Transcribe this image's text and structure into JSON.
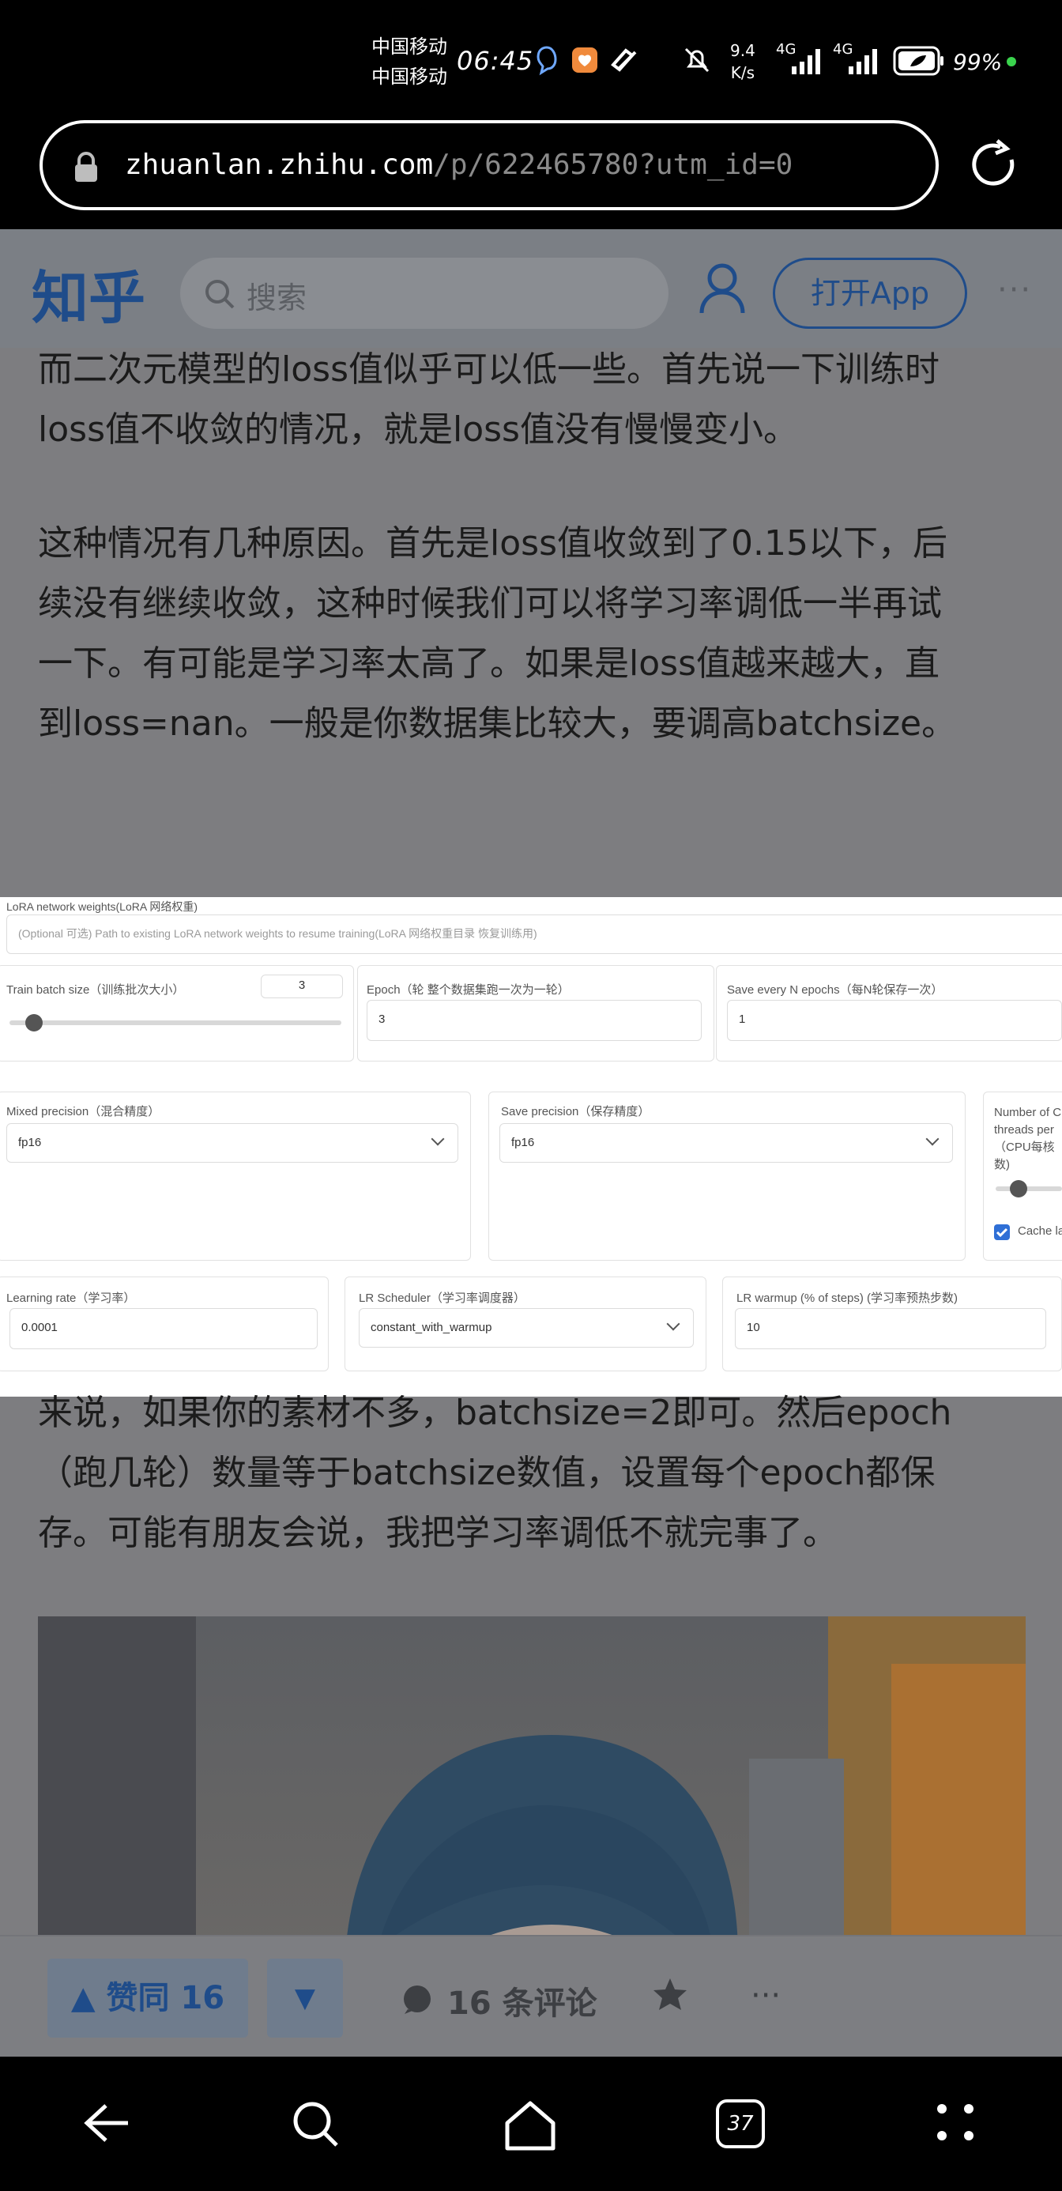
{
  "status_bar": {
    "carrier_1": "中国移动",
    "carrier_2": "中国移动",
    "time": "06:45",
    "net_speed_value": "9.4",
    "net_speed_unit": "K/s",
    "signal_1": "4G",
    "signal_2": "4G",
    "battery": "99%"
  },
  "browser": {
    "url_host": "zhuanlan.zhihu.com",
    "url_path": "/p/622465780?utm_id=0"
  },
  "site_header": {
    "logo": "知乎",
    "search_placeholder": "搜索",
    "open_app": "打开App",
    "more": "···"
  },
  "article": {
    "para1_line1": "而二次元模型的loss值似乎可以低一些。首先说一下训练时",
    "para1_line2": "loss值不收敛的情况，就是loss值没有慢慢变小。",
    "para2_line1": "这种情况有几种原因。首先是loss值收敛到了0.15以下，后",
    "para2_line2": "续没有继续收敛，这种时候我们可以将学习率调低一半再试",
    "para2_line3": "一下。有可能是学习率太高了。如果是loss值越来越大，直",
    "para2_line4": "到loss=nan。一般是你数据集比较大，要调高batchsize。",
    "para3_line1": "来说，如果你的素材不多，batchsize=2即可。然后epoch",
    "para3_line2": "（跑几轮）数量等于batchsize数值，设置每个epoch都保",
    "para3_line3": "存。可能有朋友会说，我把学习率调低不就完事了。"
  },
  "embedded_ui": {
    "lora_weights_label": "LoRA network weights(LoRA 网络权重)",
    "lora_weights_placeholder": "(Optional 可选) Path to existing LoRA network weights to resume training(LoRA 网络权重目录 恢复训练用)",
    "train_batch_label": "Train batch size（训练批次大小）",
    "train_batch_value": "3",
    "train_batch_slider_fraction": 0.05,
    "epoch_label": "Epoch（轮 整个数据集跑一次为一轮）",
    "epoch_value": "3",
    "save_every_label": "Save every N epochs（每N轮保存一次）",
    "save_every_value": "1",
    "mixed_precision_label": "Mixed precision（混合精度）",
    "mixed_precision_value": "fp16",
    "save_precision_label": "Save precision（保存精度）",
    "save_precision_value": "fp16",
    "threads_label_1": "Number of C",
    "threads_label_2": "threads per",
    "threads_label_3": "（CPU每核",
    "threads_label_4": "数)",
    "cache_label": "Cache la",
    "learning_rate_label": "Learning rate（学习率）",
    "learning_rate_value": "0.0001",
    "lr_scheduler_label": "LR Scheduler（学习率调度器）",
    "lr_scheduler_value": "constant_with_warmup",
    "lr_warmup_label": "LR warmup (% of steps) (学习率预热步数)",
    "lr_warmup_value": "10"
  },
  "action_bar": {
    "upvote": "▲ 赞同 16",
    "downvote": "▼",
    "comments": "16 条评论",
    "more": "···"
  },
  "nav_bar": {
    "tabs_count": "37"
  },
  "colors": {
    "zhihu_blue": "#1f4c8a",
    "overlay_gray": "#7d7d80"
  }
}
